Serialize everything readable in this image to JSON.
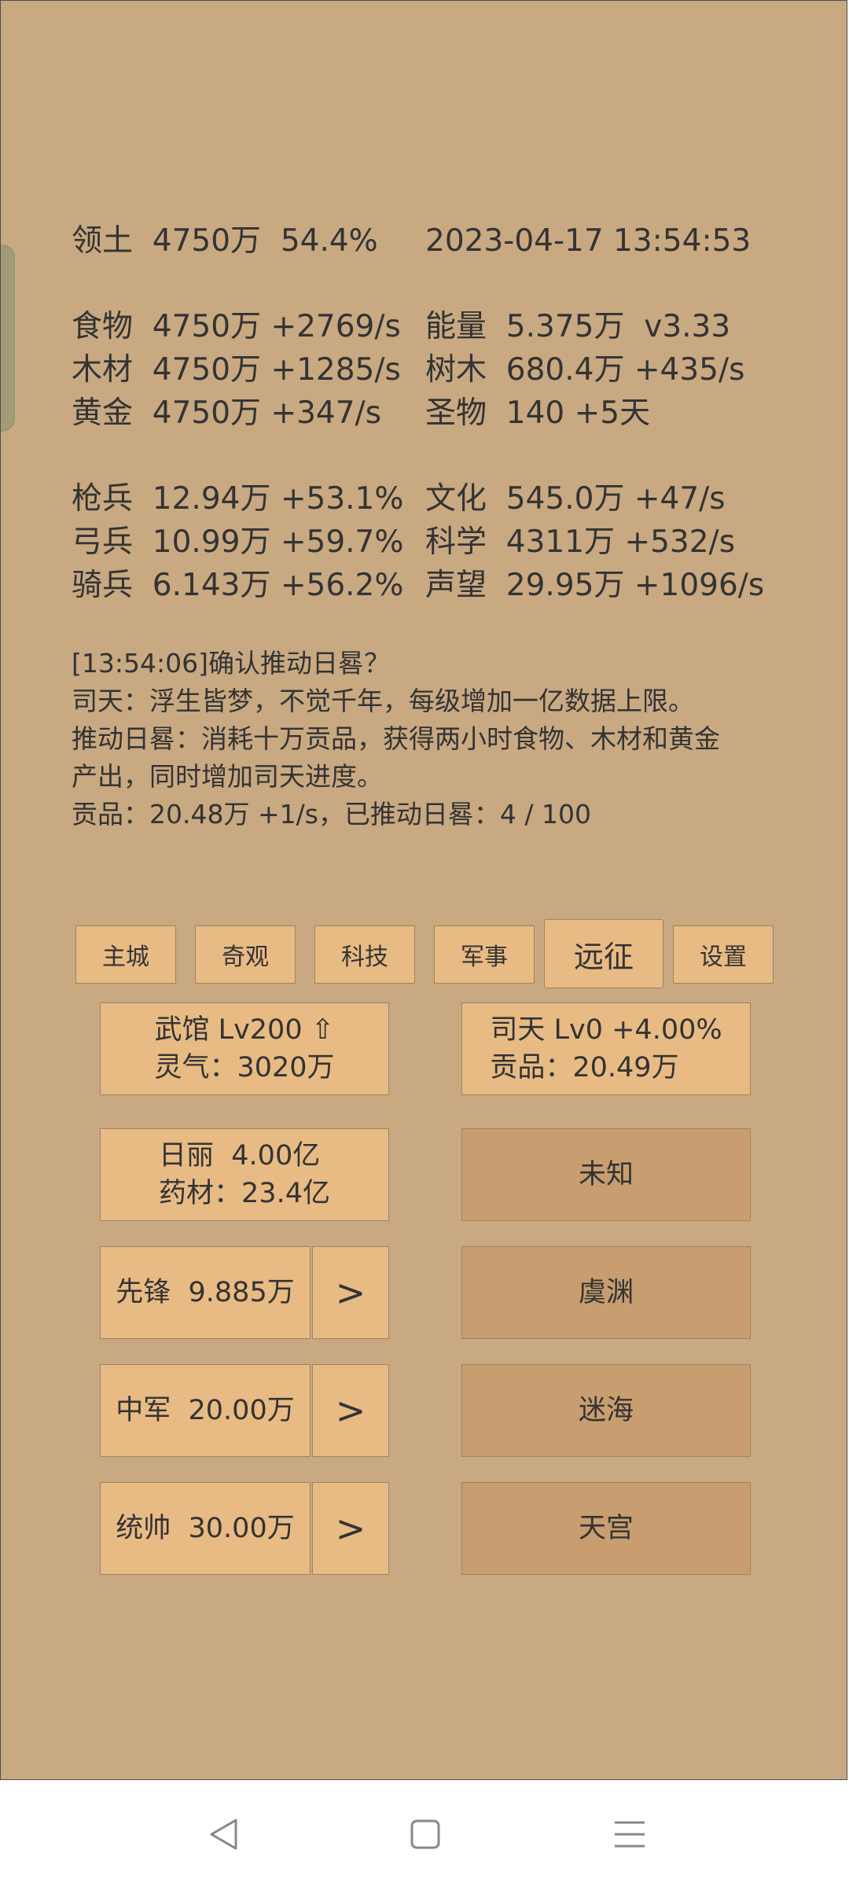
{
  "stats": {
    "territory": "领土  4750万  54.4%",
    "datetime": "2023-04-17 13:54:53",
    "food": "食物  4750万 +2769/s",
    "energy": "能量  5.375万  v3.33",
    "wood": "木材  4750万 +1285/s",
    "trees": "树木  680.4万 +435/s",
    "gold": "黄金  4750万 +347/s",
    "relics": "圣物  140 +5天",
    "spearmen": "枪兵  12.94万 +53.1%",
    "culture": "文化  545.0万 +47/s",
    "archers": "弓兵  10.99万 +59.7%",
    "science": "科学  4311万 +532/s",
    "cavalry": "骑兵  6.143万 +56.2%",
    "prestige": "声望  29.95万 +1096/s"
  },
  "log": {
    "line1": "[13:54:06]确认推动日晷？",
    "line2": "司天：浮生皆梦，不觉千年，每级增加一亿数据上限。",
    "line3": "推动日晷：消耗十万贡品，获得两小时食物、木材和黄金",
    "line4": "产出，同时增加司天进度。",
    "line5": "贡品：20.48万 +1/s，已推动日晷：4 / 100"
  },
  "tabs": [
    "主城",
    "奇观",
    "科技",
    "军事",
    "远征",
    "设置"
  ],
  "cards": {
    "wuguan": "武馆 Lv200 ⇧\n灵气：3020万",
    "sitian": "司天 Lv0 +4.00%\n贡品：20.49万",
    "rili": "日丽  4.00亿\n药材：23.4亿",
    "unknown": "未知",
    "vanguard": "先锋  9.885万",
    "vanguard_arrow": ">",
    "yuyuan": "虞渊",
    "center": "中军  20.00万",
    "center_arrow": ">",
    "mihai": "迷海",
    "commander": "统帅  30.00万",
    "commander_arrow": ">",
    "tiangong": "天宫"
  },
  "colors": {
    "background": "#c8a982",
    "button": "#e8bb84",
    "button_dark": "#c89e70",
    "text": "#333333"
  },
  "icons": [
    "back-icon",
    "home-icon",
    "menu-icon"
  ]
}
